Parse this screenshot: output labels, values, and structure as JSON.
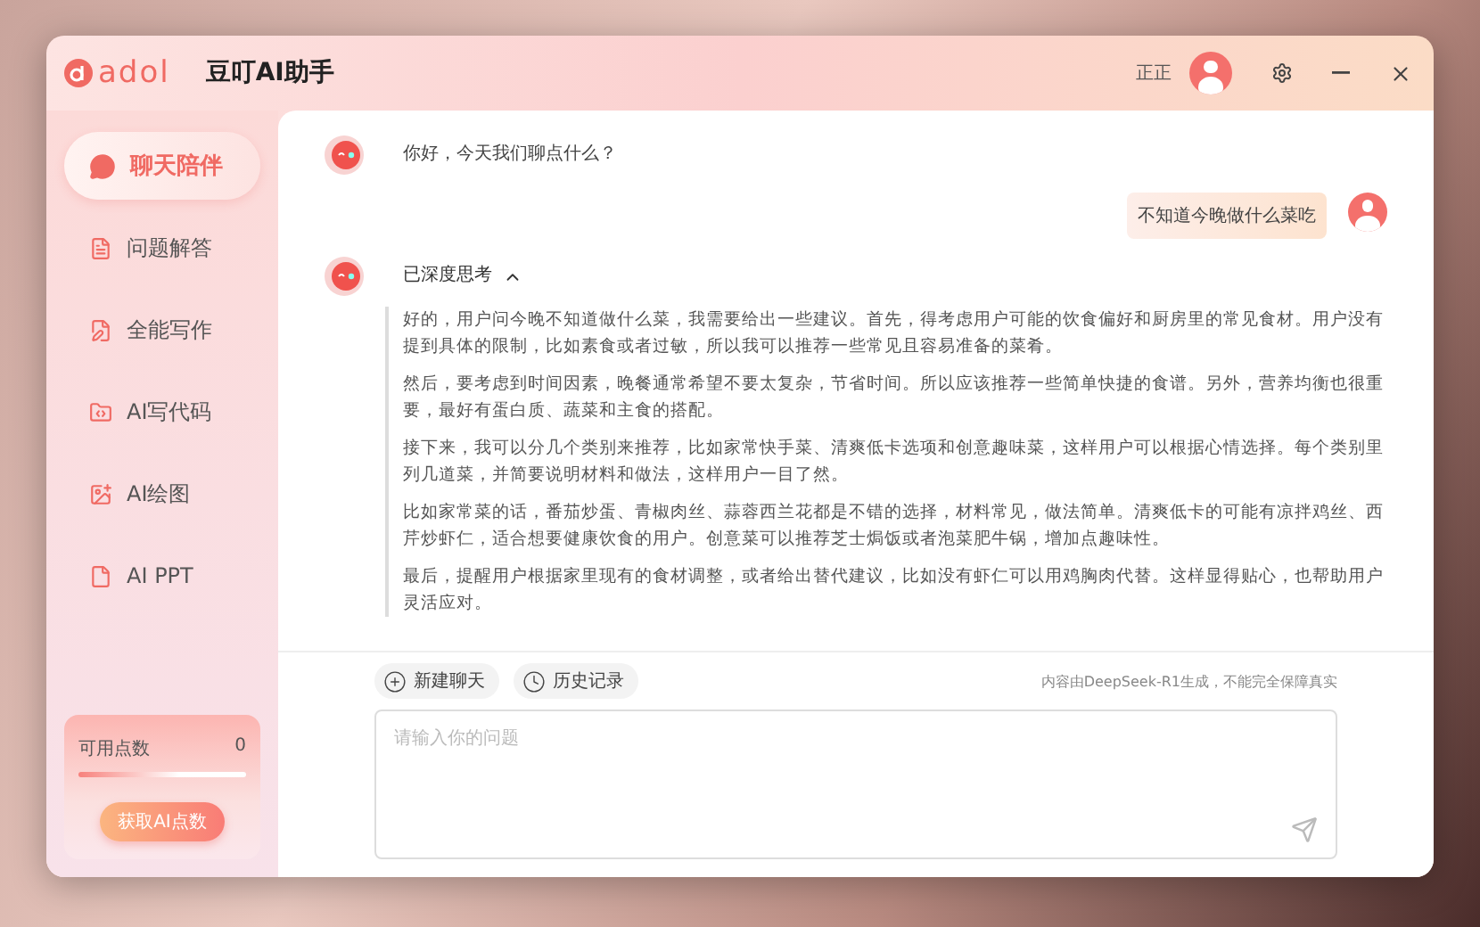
{
  "app": {
    "logo_text": "adol",
    "title": "豆叮AI助手"
  },
  "user": {
    "name": "正正"
  },
  "sidebar": {
    "items": [
      {
        "label": "聊天陪伴",
        "selected": true,
        "kind": "chat"
      },
      {
        "label": "问题解答",
        "selected": false,
        "kind": "list"
      },
      {
        "label": "全能写作",
        "selected": false,
        "kind": "write"
      },
      {
        "label": "AI写代码",
        "selected": false,
        "kind": "code"
      },
      {
        "label": "AI绘图",
        "selected": false,
        "kind": "image"
      },
      {
        "label": "AI PPT",
        "selected": false,
        "kind": "ppt"
      }
    ]
  },
  "points": {
    "label": "可用点数",
    "value": "0",
    "button": "获取AI点数"
  },
  "messages": [
    {
      "kind": "bot",
      "text": "你好，今天我们聊点什么？"
    },
    {
      "kind": "user",
      "text": "不知道今晚做什么菜吃"
    },
    {
      "kind": "thinking",
      "title": "已深度思考",
      "expanded": true,
      "paragraphs": [
        "好的，用户问今晚不知道做什么菜，我需要给出一些建议。首先，得考虑用户可能的饮食偏好和厨房里的常见食材。用户没有提到具体的限制，比如素食或者过敏，所以我可以推荐一些常见且容易准备的菜肴。",
        "然后，要考虑到时间因素，晚餐通常希望不要太复杂，节省时间。所以应该推荐一些简单快捷的食谱。另外，营养均衡也很重要，最好有蛋白质、蔬菜和主食的搭配。",
        "接下来，我可以分几个类别来推荐，比如家常快手菜、清爽低卡选项和创意趣味菜，这样用户可以根据心情选择。每个类别里列几道菜，并简要说明材料和做法，这样用户一目了然。",
        "比如家常菜的话，番茄炒蛋、青椒肉丝、蒜蓉西兰花都是不错的选择，材料常见，做法简单。清爽低卡的可能有凉拌鸡丝、西芹炒虾仁，适合想要健康饮食的用户。创意菜可以推荐芝士焗饭或者泡菜肥牛锅，增加点趣味性。",
        "最后，提醒用户根据家里现有的食材调整，或者给出替代建议，比如没有虾仁可以用鸡胸肉代替。这样显得贴心，也帮助用户灵活应对。"
      ]
    }
  ],
  "actions": [
    {
      "label": "新建聊天",
      "kind": "new"
    },
    {
      "label": "历史记录",
      "kind": "history"
    }
  ],
  "disclaimer": "内容由DeepSeek-R1生成，不能完全保障真实",
  "input": {
    "placeholder": "请输入你的问题"
  }
}
